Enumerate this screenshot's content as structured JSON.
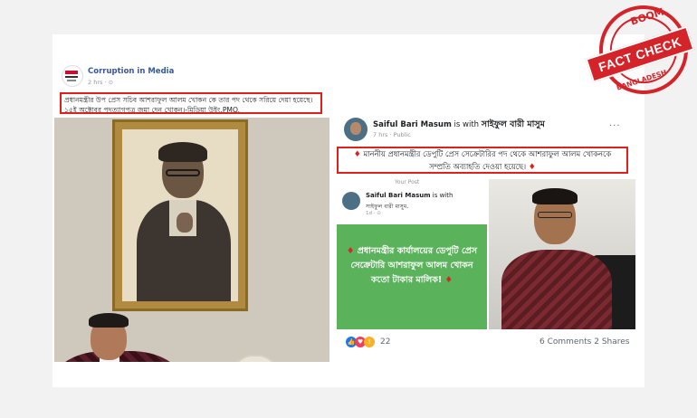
{
  "left_post": {
    "page_name": "Corruption in Media",
    "time": "2 hrs · ⊙",
    "caption": "প্রধানমন্ত্রীর উপ প্রেস সচিব আশরাফুল আলম খোকন কে তার পদ থেকে সরিয়ে দেয়া হয়েছে। ১৫ই অক্টোবর পদত্যাগপত্র জমা দেন খোকন।-মিডিয়া উইং,PMO."
  },
  "right_post": {
    "author": "Saiful Bari Masum",
    "with_text": "is with",
    "with_name": "সাইফুল বারী মাসুম",
    "time": "7 hrs · Public",
    "more": "···",
    "caption": "মাননীয় প্রধানমন্ত্রীর ডেপুটি প্রেস সেক্রেটারির পদ থেকে আশরাফুল আলম খোকনকে সম্প্রতি অব্যাহতি দেওয়া হয়েছে।",
    "shared": {
      "label": "Your Post",
      "author": "Saiful Bari Masum",
      "with_text": "is with",
      "with_name": "সাইফুল বারী মাসুম.",
      "time": "1d · ⊙",
      "green_text": "প্রধানমন্ত্রীর কার্যালয়ের ডেপুটি প্রেস সেক্রেটারি আশরাফুল আলম খোকন কতো টাকার মালিক!"
    },
    "reactions_count": "22",
    "stats": "6 Comments  2 Shares"
  },
  "stamp": {
    "top": "BOOM",
    "band": "FACT CHECK",
    "bottom": "BANGLADESH"
  },
  "colors": {
    "highlight_red": "#e0201b",
    "stamp_red": "#d4242a",
    "fb_link": "#385898",
    "green_card": "#5ab25a"
  }
}
